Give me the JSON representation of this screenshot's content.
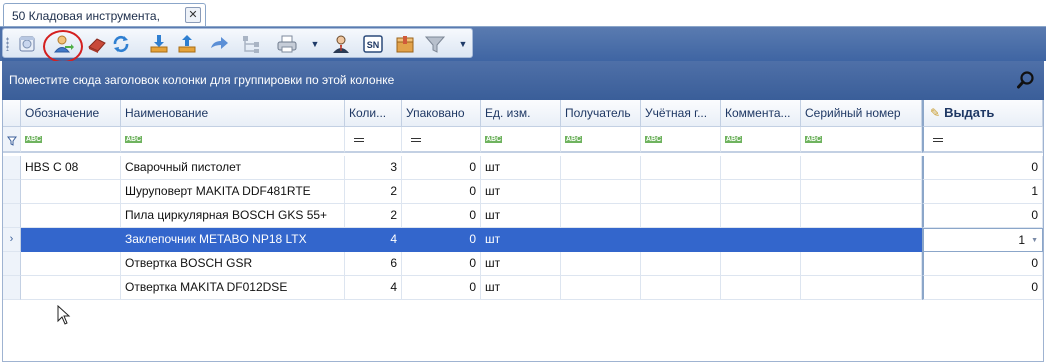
{
  "tab": {
    "title": "50 Кладовая инструмента,",
    "close_glyph": "✕"
  },
  "toolbar": {
    "buttons": [
      {
        "name": "calendar-icon"
      },
      {
        "name": "user-issue-icon",
        "highlighted": true
      },
      {
        "name": "eraser-icon"
      },
      {
        "name": "refresh-icon"
      },
      {
        "name": "download-icon"
      },
      {
        "name": "upload-icon"
      },
      {
        "name": "forward-icon"
      },
      {
        "name": "hierarchy-icon"
      },
      {
        "name": "printer-icon"
      },
      {
        "name": "person-icon"
      },
      {
        "name": "serial-number-icon"
      },
      {
        "name": "box-icon"
      },
      {
        "name": "filter-icon"
      }
    ],
    "sn_text": "SN",
    "dropdown_glyph": "▼"
  },
  "group_panel": {
    "text": "Поместите сюда заголовок колонки для группировки по этой колонке"
  },
  "grid": {
    "columns": [
      {
        "key": "code",
        "label": "Обозначение"
      },
      {
        "key": "name",
        "label": "Наименование"
      },
      {
        "key": "qty",
        "label": "Коли..."
      },
      {
        "key": "packed",
        "label": "Упаковано"
      },
      {
        "key": "unit",
        "label": "Ед. изм."
      },
      {
        "key": "recipient",
        "label": "Получатель"
      },
      {
        "key": "account",
        "label": "Учётная г..."
      },
      {
        "key": "comment",
        "label": "Коммента..."
      },
      {
        "key": "serial",
        "label": "Серийный номер"
      },
      {
        "key": "issue",
        "label": "Выдать"
      }
    ],
    "filter_abc": "ABC",
    "rows": [
      {
        "code": "HBS C 08",
        "name": "Сварочный пистолет",
        "qty": "3",
        "packed": "0",
        "unit": "шт",
        "issue": "0",
        "selected": false
      },
      {
        "code": "",
        "name": "Шуруповерт MAKITA DDF481RTE",
        "qty": "2",
        "packed": "0",
        "unit": "шт",
        "issue": "1",
        "selected": false
      },
      {
        "code": "",
        "name": "Пила циркулярная BOSCH GKS 55+",
        "qty": "2",
        "packed": "0",
        "unit": "шт",
        "issue": "0",
        "selected": false
      },
      {
        "code": "",
        "name": "Заклепочник METABO NP18 LTX",
        "qty": "4",
        "packed": "0",
        "unit": "шт",
        "issue": "1",
        "selected": true
      },
      {
        "code": "",
        "name": "Отвертка BOSCH GSR",
        "qty": "6",
        "packed": "0",
        "unit": "шт",
        "issue": "0",
        "selected": false
      },
      {
        "code": "",
        "name": "Отвертка MAKITA DF012DSE",
        "qty": "4",
        "packed": "0",
        "unit": "шт",
        "issue": "0",
        "selected": false
      }
    ],
    "row_indicator_glyph": "›"
  },
  "colors": {
    "accent": "#3366cc",
    "band": "#3f65a3",
    "highlight_ring": "#d42020"
  }
}
